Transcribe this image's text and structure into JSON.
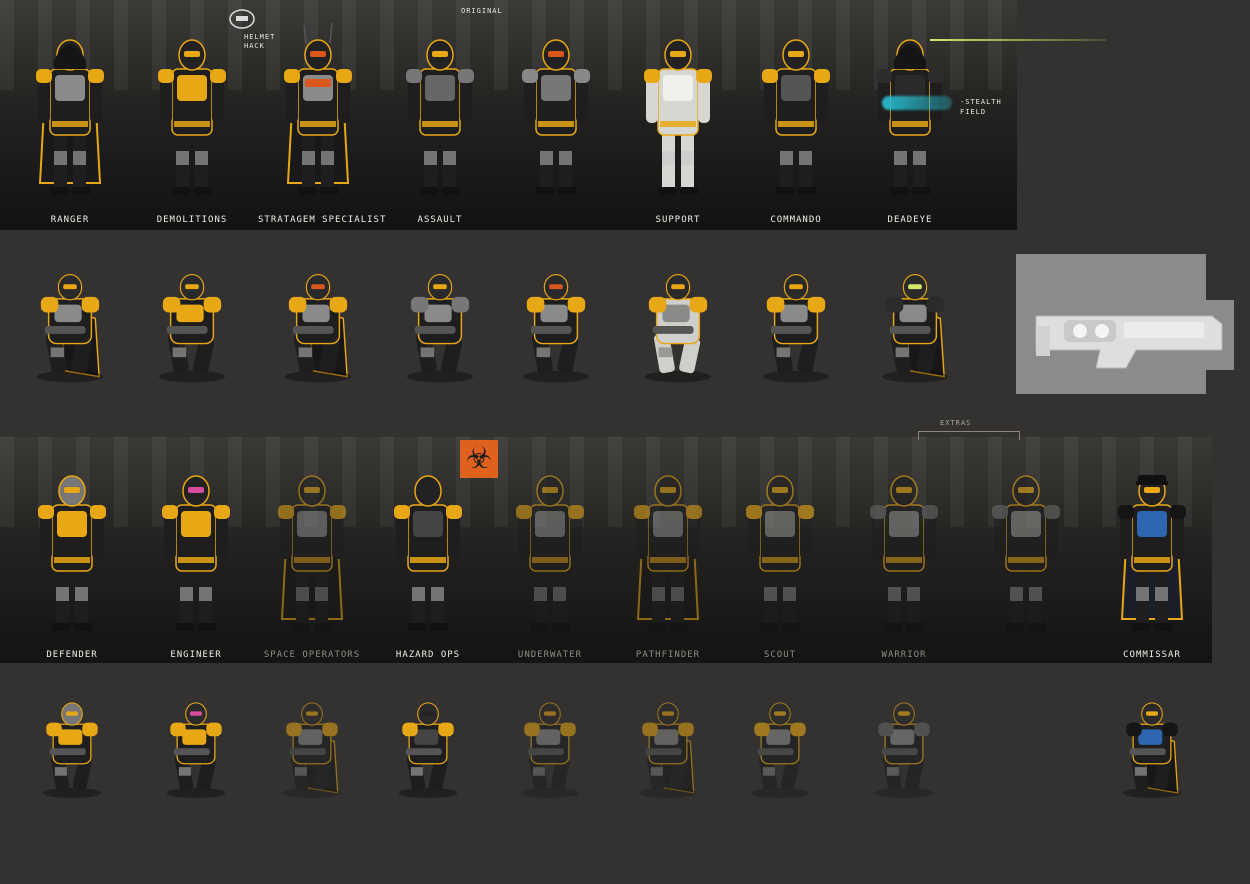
{
  "notes": {
    "original": "ORIGINAL",
    "helmet_hack": "HELMET\nHACK",
    "stealth_field": "-STEALTH\nFIELD",
    "extras": "EXTRAS"
  },
  "colors": {
    "background": "#333230",
    "armor_yellow": "#e8a715",
    "armor_dark": "#1e1e1e",
    "armor_grey": "#8a8a88",
    "accent_orange": "#d9571c",
    "accent_cyan": "#3fc7d8",
    "visor_magenta": "#d84a9c",
    "commissar_blue": "#2f66b0",
    "biohazard": "#e0611d"
  },
  "row1": [
    {
      "label": "RANGER"
    },
    {
      "label": "DEMOLITIONS"
    },
    {
      "label": "STRATAGEM SPECIALIST"
    },
    {
      "label": "ASSAULT"
    },
    {
      "label": ""
    },
    {
      "label": "SUPPORT"
    },
    {
      "label": "COMMANDO"
    },
    {
      "label": "DEADEYE"
    }
  ],
  "row3": [
    {
      "label": "DEFENDER"
    },
    {
      "label": "ENGINEER"
    },
    {
      "label": "SPACE OPERATORS"
    },
    {
      "label": "HAZARD OPS"
    },
    {
      "label": "UNDERWATER"
    },
    {
      "label": "PATHFINDER"
    },
    {
      "label": "SCOUT"
    },
    {
      "label": "WARRIOR"
    },
    {
      "label": ""
    },
    {
      "label": "COMMISSAR"
    }
  ],
  "icons": {
    "biohazard": "biohazard-icon",
    "weapon": "rifle-render"
  }
}
